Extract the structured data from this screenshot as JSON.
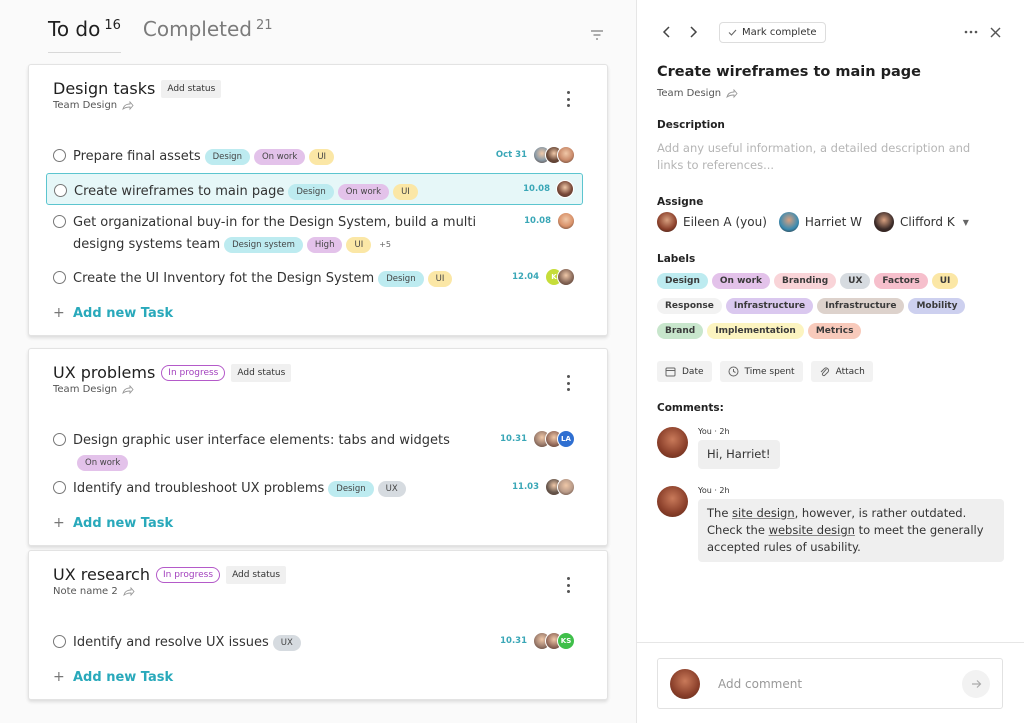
{
  "tabs": [
    {
      "label": "To do",
      "count": "16",
      "active": true
    },
    {
      "label": "Completed",
      "count": "21",
      "active": false
    }
  ],
  "colors": {
    "accent": "#29a9bb",
    "selected_bg": "#e6f7f8",
    "selected_border": "#5cc5cf",
    "status_purple": "#a23fbd"
  },
  "tag_colors": {
    "Design": "#bdebf0",
    "On work": "#e3c2ea",
    "UI": "#fbe7a6",
    "Design system": "#bdebf0",
    "High": "#e3c2ea",
    "UX": "#d6dbe0"
  },
  "groups": [
    {
      "title": "Design tasks",
      "status": "",
      "add_status": "Add status",
      "subtitle": "Team Design",
      "tasks": [
        {
          "text": "Prepare final assets",
          "tags": [
            "Design",
            "On work",
            "UI"
          ],
          "extra": "",
          "due": "Oct 31",
          "selected": false,
          "assignees": [
            {
              "initials": "",
              "color": "#8a9aa6"
            },
            {
              "initials": "",
              "color": "#6b4a3a"
            },
            {
              "initials": "",
              "color": "#c98a6a"
            }
          ]
        },
        {
          "text": "Create wireframes  to main page",
          "tags": [
            "Design",
            "On work",
            "UI"
          ],
          "extra": "",
          "due": "10.08",
          "selected": true,
          "assignees": [
            {
              "initials": "",
              "color": "#7a4a3a"
            }
          ]
        },
        {
          "text": "Get organizational buy-in for the Design System, build a multi designg systems team",
          "tags": [
            "Design system",
            "High",
            "UI"
          ],
          "extra": "+5",
          "due": "10.08",
          "selected": false,
          "assignees": [
            {
              "initials": "",
              "color": "#d9926a"
            }
          ]
        },
        {
          "text": "Create the UI Inventory fot the Design System",
          "tags": [
            "Design",
            "UI"
          ],
          "extra": "",
          "due": "12.04",
          "selected": false,
          "assignees": [
            {
              "initials": "K",
              "color": "#c6dd3a"
            },
            {
              "initials": "",
              "color": "#8a6a5a"
            }
          ]
        }
      ],
      "add_task": "Add new Task"
    },
    {
      "title": "UX problems",
      "status": "In progress",
      "add_status": "Add status",
      "subtitle": "Team Design",
      "tasks": [
        {
          "text": "Design graphic user interface elements: tabs and widgets",
          "tags": [
            "On work"
          ],
          "extra": "",
          "due": "10.31",
          "selected": false,
          "assignees": [
            {
              "initials": "",
              "color": "#a08070"
            },
            {
              "initials": "",
              "color": "#9a7060"
            },
            {
              "initials": "LA",
              "color": "#2f6fd1"
            }
          ]
        },
        {
          "text": "Identify and troubleshoot UX problems",
          "tags": [
            "Design",
            "UX"
          ],
          "extra": "",
          "due": "11.03",
          "selected": false,
          "assignees": [
            {
              "initials": "",
              "color": "#6a5a50"
            },
            {
              "initials": "",
              "color": "#b89a88"
            }
          ]
        }
      ],
      "add_task": "Add new Task"
    },
    {
      "title": "UX research",
      "status": "In progress",
      "add_status": "Add status",
      "subtitle": "Note name 2",
      "tasks": [
        {
          "text": "Identify and resolve UX issues",
          "tags": [
            "UX"
          ],
          "extra": "",
          "due": "10.31",
          "selected": false,
          "assignees": [
            {
              "initials": "",
              "color": "#a08070"
            },
            {
              "initials": "",
              "color": "#9a7060"
            },
            {
              "initials": "KS",
              "color": "#3fbf4a"
            }
          ]
        }
      ],
      "add_task": "Add new Task"
    }
  ],
  "detail": {
    "mark_complete": "Mark complete",
    "title": "Create wireframes to main page",
    "subtitle": "Team Design",
    "description_label": "Description",
    "description_placeholder": "Add any useful information, a detailed description and links to references...",
    "assignee_label": "Assigne",
    "assignees": [
      {
        "name": "Eileen A (you)",
        "color": "#8a3f2a"
      },
      {
        "name": "Harriet W",
        "color": "#3a8ab0"
      },
      {
        "name": "Clifford K",
        "color": "#3a2a28"
      }
    ],
    "labels_label": "Labels",
    "labels": [
      {
        "text": "Design",
        "color": "#bdebf0"
      },
      {
        "text": "On work",
        "color": "#e3c2ea"
      },
      {
        "text": "Branding",
        "color": "#f9d4d8"
      },
      {
        "text": "UX",
        "color": "#d6dbe0"
      },
      {
        "text": "Factors",
        "color": "#f6bfcc"
      },
      {
        "text": "UI",
        "color": "#fbe7a6"
      },
      {
        "text": "Response",
        "color": "#f2f2f2"
      },
      {
        "text": "Infrastructure",
        "color": "#dac8ef"
      },
      {
        "text": "Infrastructure",
        "color": "#ddd2cc"
      },
      {
        "text": "Mobility",
        "color": "#cdd0ef"
      },
      {
        "text": "Brand",
        "color": "#c8e6cc"
      },
      {
        "text": "Implementation",
        "color": "#fcf4c0"
      },
      {
        "text": "Metrics",
        "color": "#f8cabb"
      }
    ],
    "actions": [
      {
        "label": "Date",
        "icon": "calendar-icon"
      },
      {
        "label": "Time spent",
        "icon": "clock-icon"
      },
      {
        "label": "Attach",
        "icon": "paperclip-icon"
      }
    ],
    "comments_label": "Comments:",
    "comments": [
      {
        "author": "You · 2h",
        "parts": [
          {
            "t": "Hi, Harriet!",
            "u": false
          }
        ]
      },
      {
        "author": "You · 2h",
        "parts": [
          {
            "t": "The ",
            "u": false
          },
          {
            "t": "site design",
            "u": true
          },
          {
            "t": ", however, is rather outdated. Check the ",
            "u": false
          },
          {
            "t": "website design",
            "u": true
          },
          {
            "t": " to meet the generally accepted rules of usability.",
            "u": false
          }
        ]
      }
    ],
    "comment_placeholder": "Add comment"
  }
}
